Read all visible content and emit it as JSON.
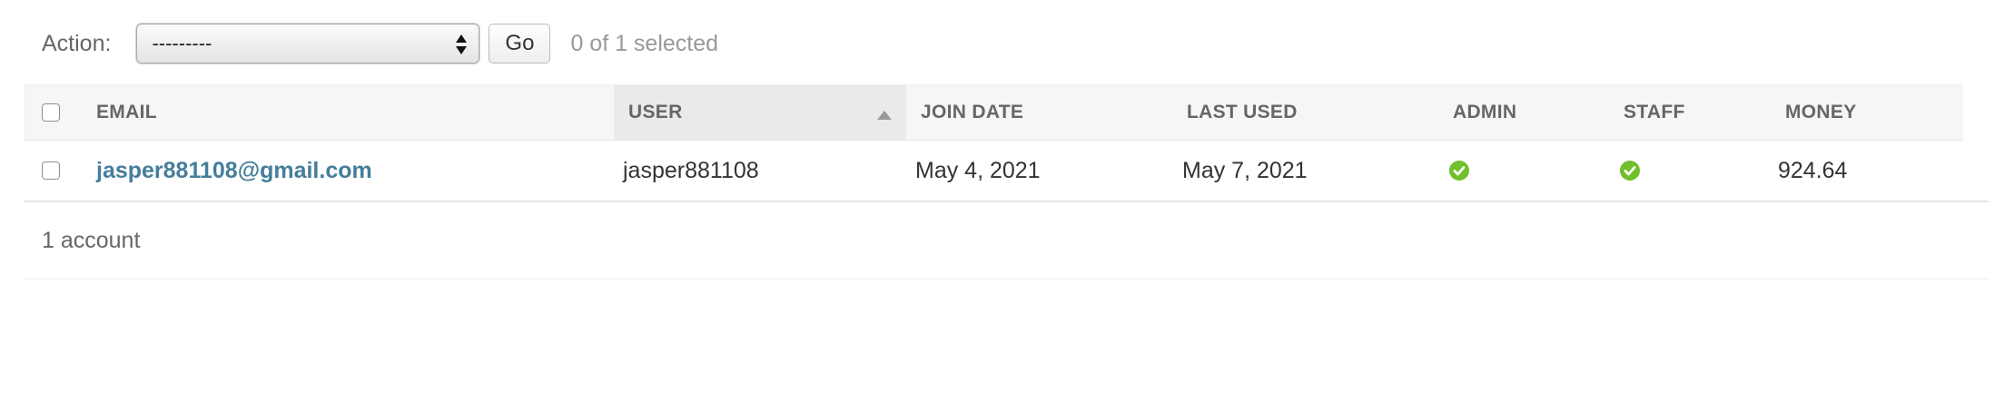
{
  "actions": {
    "label": "Action:",
    "selected_option": "---------",
    "go_label": "Go",
    "selection_counter": "0 of 1 selected"
  },
  "table": {
    "columns": [
      {
        "label": "Email"
      },
      {
        "label": "User",
        "sorted": "ascending"
      },
      {
        "label": "Join date"
      },
      {
        "label": "Last used"
      },
      {
        "label": "Admin"
      },
      {
        "label": "Staff"
      },
      {
        "label": "Money"
      }
    ],
    "rows": [
      {
        "email": "jasper881108@gmail.com",
        "user": "jasper881108",
        "join_date": "May 4, 2021",
        "last_used": "May 7, 2021",
        "admin": true,
        "staff": true,
        "money": "924.64"
      }
    ]
  },
  "paginator": {
    "text": "1 account"
  },
  "colors": {
    "link": "#447e9b",
    "yes_icon": "#70bf2b",
    "header_bg": "#f6f6f6",
    "sorted_header_bg": "#eaeaea"
  },
  "icons": {
    "boolean_true": "check-circle-icon"
  }
}
